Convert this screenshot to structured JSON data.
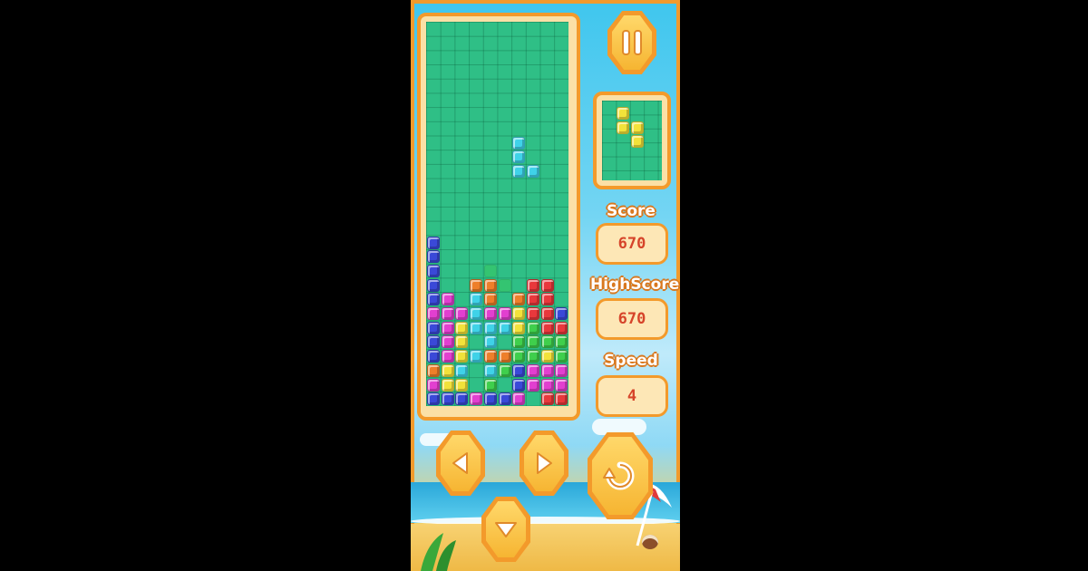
{
  "game": {
    "stats": {
      "score_label": "Score",
      "score_value": "670",
      "highscore_label": "HighScore",
      "highscore_value": "670",
      "speed_label": "Speed",
      "speed_value": "4"
    },
    "colors": {
      "board": "#2fbf86",
      "frame": "#f39a2b",
      "blue": "#3a49d8",
      "magenta": "#e23fd0",
      "orange": "#ee7f2a",
      "red": "#e8383c",
      "cyan": "#3fd2e8",
      "yellow": "#f2e23a",
      "green": "#3fcf4c"
    },
    "board": {
      "columns": 10,
      "rows": 27,
      "rows_data": [
        "B.........",
        "B.........",
        "B...g.....",
        "B..OOg.RR.",
        "BM.CO.ORR.",
        "MMMCMMYRRB",
        "BMYCCCYGRR",
        "BMY.C.GGGG",
        "BMYCOOGGYG",
        "OYC.CGBMMM",
        "MYY.G.BMMM",
        "BBBMBBM.RR"
      ],
      "falling_piece": {
        "color": "cyan",
        "cells": [
          [
            6,
            8
          ],
          [
            6,
            9
          ],
          [
            6,
            10
          ],
          [
            7,
            10
          ]
        ]
      }
    },
    "next_piece": {
      "color": "yellow",
      "cells": [
        [
          1,
          1
        ],
        [
          1,
          2
        ],
        [
          2,
          2
        ],
        [
          2,
          3
        ]
      ]
    },
    "buttons": [
      "pause",
      "left",
      "right",
      "rotate",
      "down"
    ]
  }
}
